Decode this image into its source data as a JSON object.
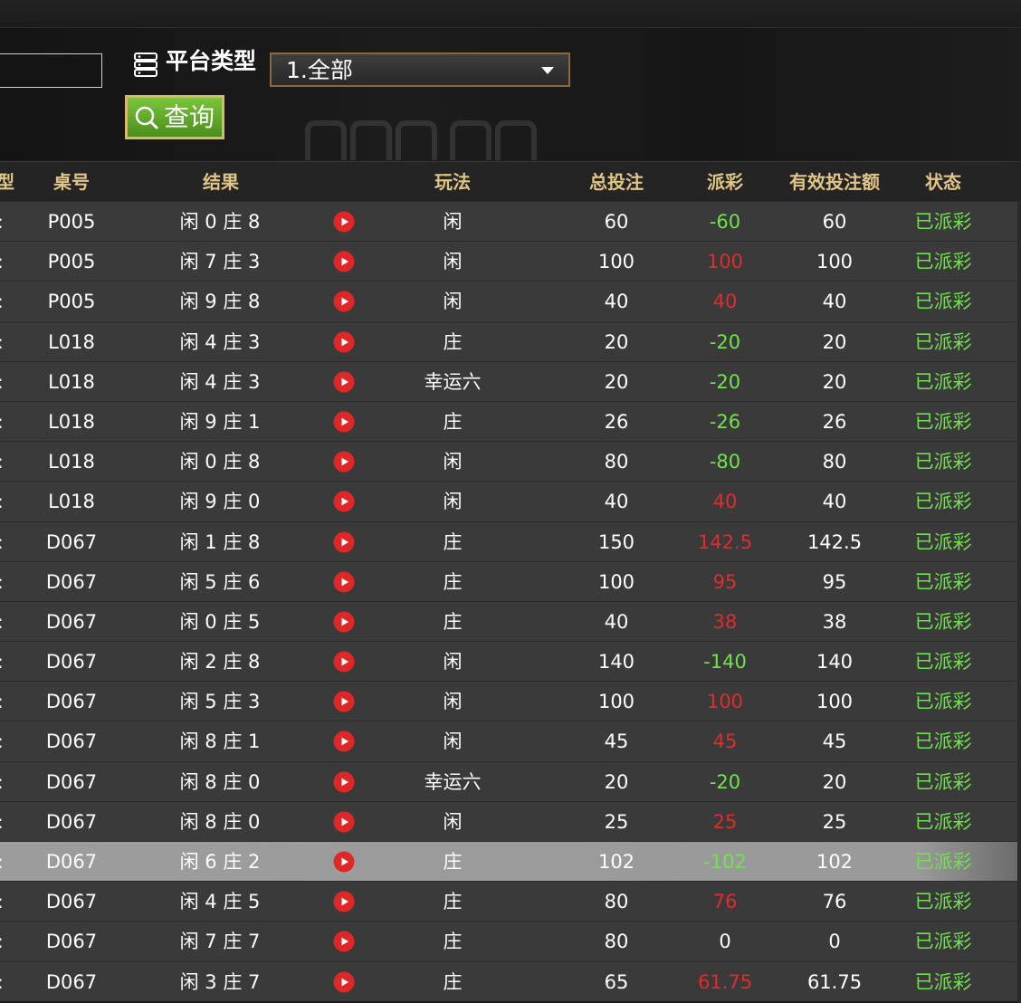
{
  "filters": {
    "platform_label": "平台类型",
    "platform_value": "1.全部",
    "query_label": "查询"
  },
  "headers": {
    "col0": "型",
    "table": "桌号",
    "result": "结果",
    "play": "玩法",
    "total_bet": "总投注",
    "payout": "派彩",
    "valid_bet": "有效投注额",
    "status": "状态"
  },
  "rows": [
    {
      "table": "P005",
      "result": "闲 0 庄 8",
      "play": "闲",
      "total": "60",
      "payout": "-60",
      "payout_type": "neg",
      "valid": "60",
      "status": "已派彩"
    },
    {
      "table": "P005",
      "result": "闲 7 庄 3",
      "play": "闲",
      "total": "100",
      "payout": "100",
      "payout_type": "pos",
      "valid": "100",
      "status": "已派彩"
    },
    {
      "table": "P005",
      "result": "闲 9 庄 8",
      "play": "闲",
      "total": "40",
      "payout": "40",
      "payout_type": "pos",
      "valid": "40",
      "status": "已派彩"
    },
    {
      "table": "L018",
      "result": "闲 4 庄 3",
      "play": "庄",
      "total": "20",
      "payout": "-20",
      "payout_type": "neg",
      "valid": "20",
      "status": "已派彩"
    },
    {
      "table": "L018",
      "result": "闲 4 庄 3",
      "play": "幸运六",
      "total": "20",
      "payout": "-20",
      "payout_type": "neg",
      "valid": "20",
      "status": "已派彩"
    },
    {
      "table": "L018",
      "result": "闲 9 庄 1",
      "play": "庄",
      "total": "26",
      "payout": "-26",
      "payout_type": "neg",
      "valid": "26",
      "status": "已派彩"
    },
    {
      "table": "L018",
      "result": "闲 0 庄 8",
      "play": "闲",
      "total": "80",
      "payout": "-80",
      "payout_type": "neg",
      "valid": "80",
      "status": "已派彩"
    },
    {
      "table": "L018",
      "result": "闲 9 庄 0",
      "play": "闲",
      "total": "40",
      "payout": "40",
      "payout_type": "pos",
      "valid": "40",
      "status": "已派彩"
    },
    {
      "table": "D067",
      "result": "闲 1 庄 8",
      "play": "庄",
      "total": "150",
      "payout": "142.5",
      "payout_type": "pos",
      "valid": "142.5",
      "status": "已派彩"
    },
    {
      "table": "D067",
      "result": "闲 5 庄 6",
      "play": "庄",
      "total": "100",
      "payout": "95",
      "payout_type": "pos",
      "valid": "95",
      "status": "已派彩"
    },
    {
      "table": "D067",
      "result": "闲 0 庄 5",
      "play": "庄",
      "total": "40",
      "payout": "38",
      "payout_type": "pos",
      "valid": "38",
      "status": "已派彩"
    },
    {
      "table": "D067",
      "result": "闲 2 庄 8",
      "play": "闲",
      "total": "140",
      "payout": "-140",
      "payout_type": "neg",
      "valid": "140",
      "status": "已派彩"
    },
    {
      "table": "D067",
      "result": "闲 5 庄 3",
      "play": "闲",
      "total": "100",
      "payout": "100",
      "payout_type": "pos",
      "valid": "100",
      "status": "已派彩"
    },
    {
      "table": "D067",
      "result": "闲 8 庄 1",
      "play": "闲",
      "total": "45",
      "payout": "45",
      "payout_type": "pos",
      "valid": "45",
      "status": "已派彩"
    },
    {
      "table": "D067",
      "result": "闲 8 庄 0",
      "play": "幸运六",
      "total": "20",
      "payout": "-20",
      "payout_type": "neg",
      "valid": "20",
      "status": "已派彩"
    },
    {
      "table": "D067",
      "result": "闲 8 庄 0",
      "play": "闲",
      "total": "25",
      "payout": "25",
      "payout_type": "pos",
      "valid": "25",
      "status": "已派彩"
    },
    {
      "table": "D067",
      "result": "闲 6 庄 2",
      "play": "庄",
      "total": "102",
      "payout": "-102",
      "payout_type": "neg",
      "valid": "102",
      "status": "已派彩",
      "highlighted": true
    },
    {
      "table": "D067",
      "result": "闲 4 庄 5",
      "play": "庄",
      "total": "80",
      "payout": "76",
      "payout_type": "pos",
      "valid": "76",
      "status": "已派彩"
    },
    {
      "table": "D067",
      "result": "闲 7 庄 7",
      "play": "庄",
      "total": "80",
      "payout": "0",
      "payout_type": "zero",
      "valid": "0",
      "status": "已派彩"
    },
    {
      "table": "D067",
      "result": "闲 3 庄 7",
      "play": "庄",
      "total": "65",
      "payout": "61.75",
      "payout_type": "pos",
      "valid": "61.75",
      "status": "已派彩"
    }
  ],
  "colors": {
    "header_text": "#e0c585",
    "payout_negative": "#6ee34a",
    "payout_positive": "#e02c2c",
    "status": "#6ee34a",
    "query_button": "#5fa82a",
    "query_border": "#d9b86c"
  }
}
